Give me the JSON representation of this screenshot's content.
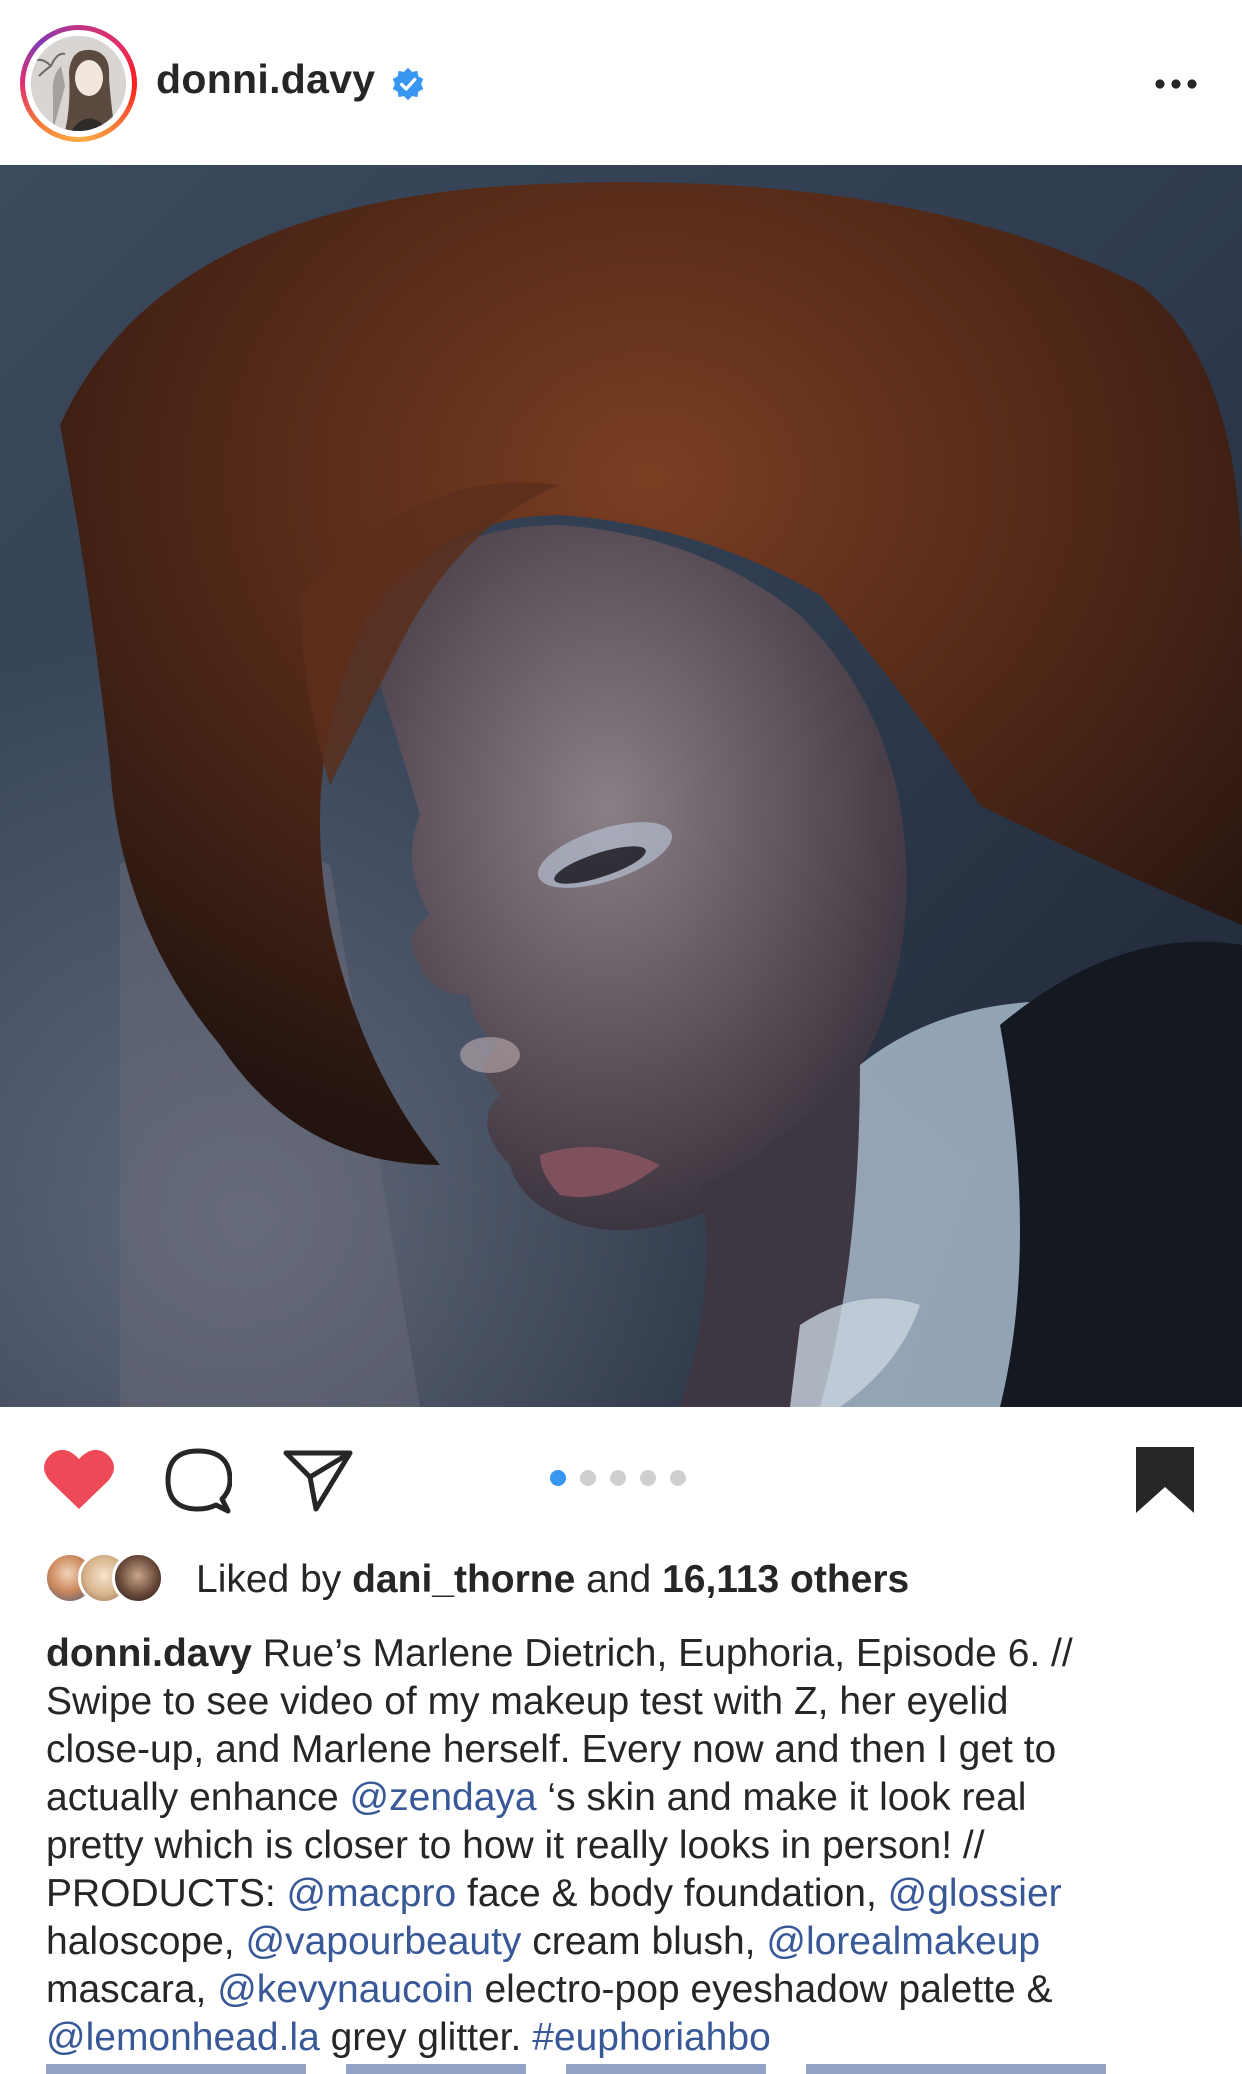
{
  "header": {
    "username": "donni.davy",
    "icons": {
      "verified": "verified-badge-icon",
      "more": "more-options-icon"
    },
    "colors": {
      "verified": "#3897f0"
    }
  },
  "post": {
    "carousel": {
      "total": 5,
      "active": 1
    },
    "colors": {
      "like_active": "#ed4956",
      "dot_active": "#3897f0",
      "dot_inactive": "#cfcfcf",
      "mention": "#385898"
    }
  },
  "actions": {
    "icons": [
      "heart-icon",
      "comment-icon",
      "share-icon",
      "bookmark-icon"
    ]
  },
  "likes": {
    "prefix": "Liked by",
    "user": "dani_thorne",
    "and": "and",
    "count": "16,113 others"
  },
  "caption": {
    "username": "donni.davy",
    "line1_text": " Rue’s Marlene Dietrich, Euphoria, Episode 6. //",
    "line2": "Swipe to see video of my makeup test with Z, her eyelid",
    "line3": "close-up, and Marlene herself. Every now and then I get to",
    "line4_pre": "actually enhance ",
    "mention_zendaya": "@zendaya",
    "line4_post": " ‘s skin and make it look real",
    "line5": "pretty which is closer to how it really looks in person! //",
    "line6_pre": "PRODUCTS: ",
    "mention_macpro": "@macpro",
    "line6_mid": " face & body foundation, ",
    "mention_glossier": "@glossier",
    "line7_pre": "haloscope, ",
    "mention_vapour": "@vapourbeauty",
    "line7_mid": " cream blush, ",
    "mention_loreal": "@lorealmakeup",
    "line8_pre": "mascara, ",
    "mention_kevyn": "@kevynaucoin",
    "line8_post": " electro-pop eyeshadow palette &",
    "mention_lemonhead": "@lemonhead.la",
    "line9_mid": " grey glitter. ",
    "hashtag_euphoria": "#euphoriahbo"
  }
}
